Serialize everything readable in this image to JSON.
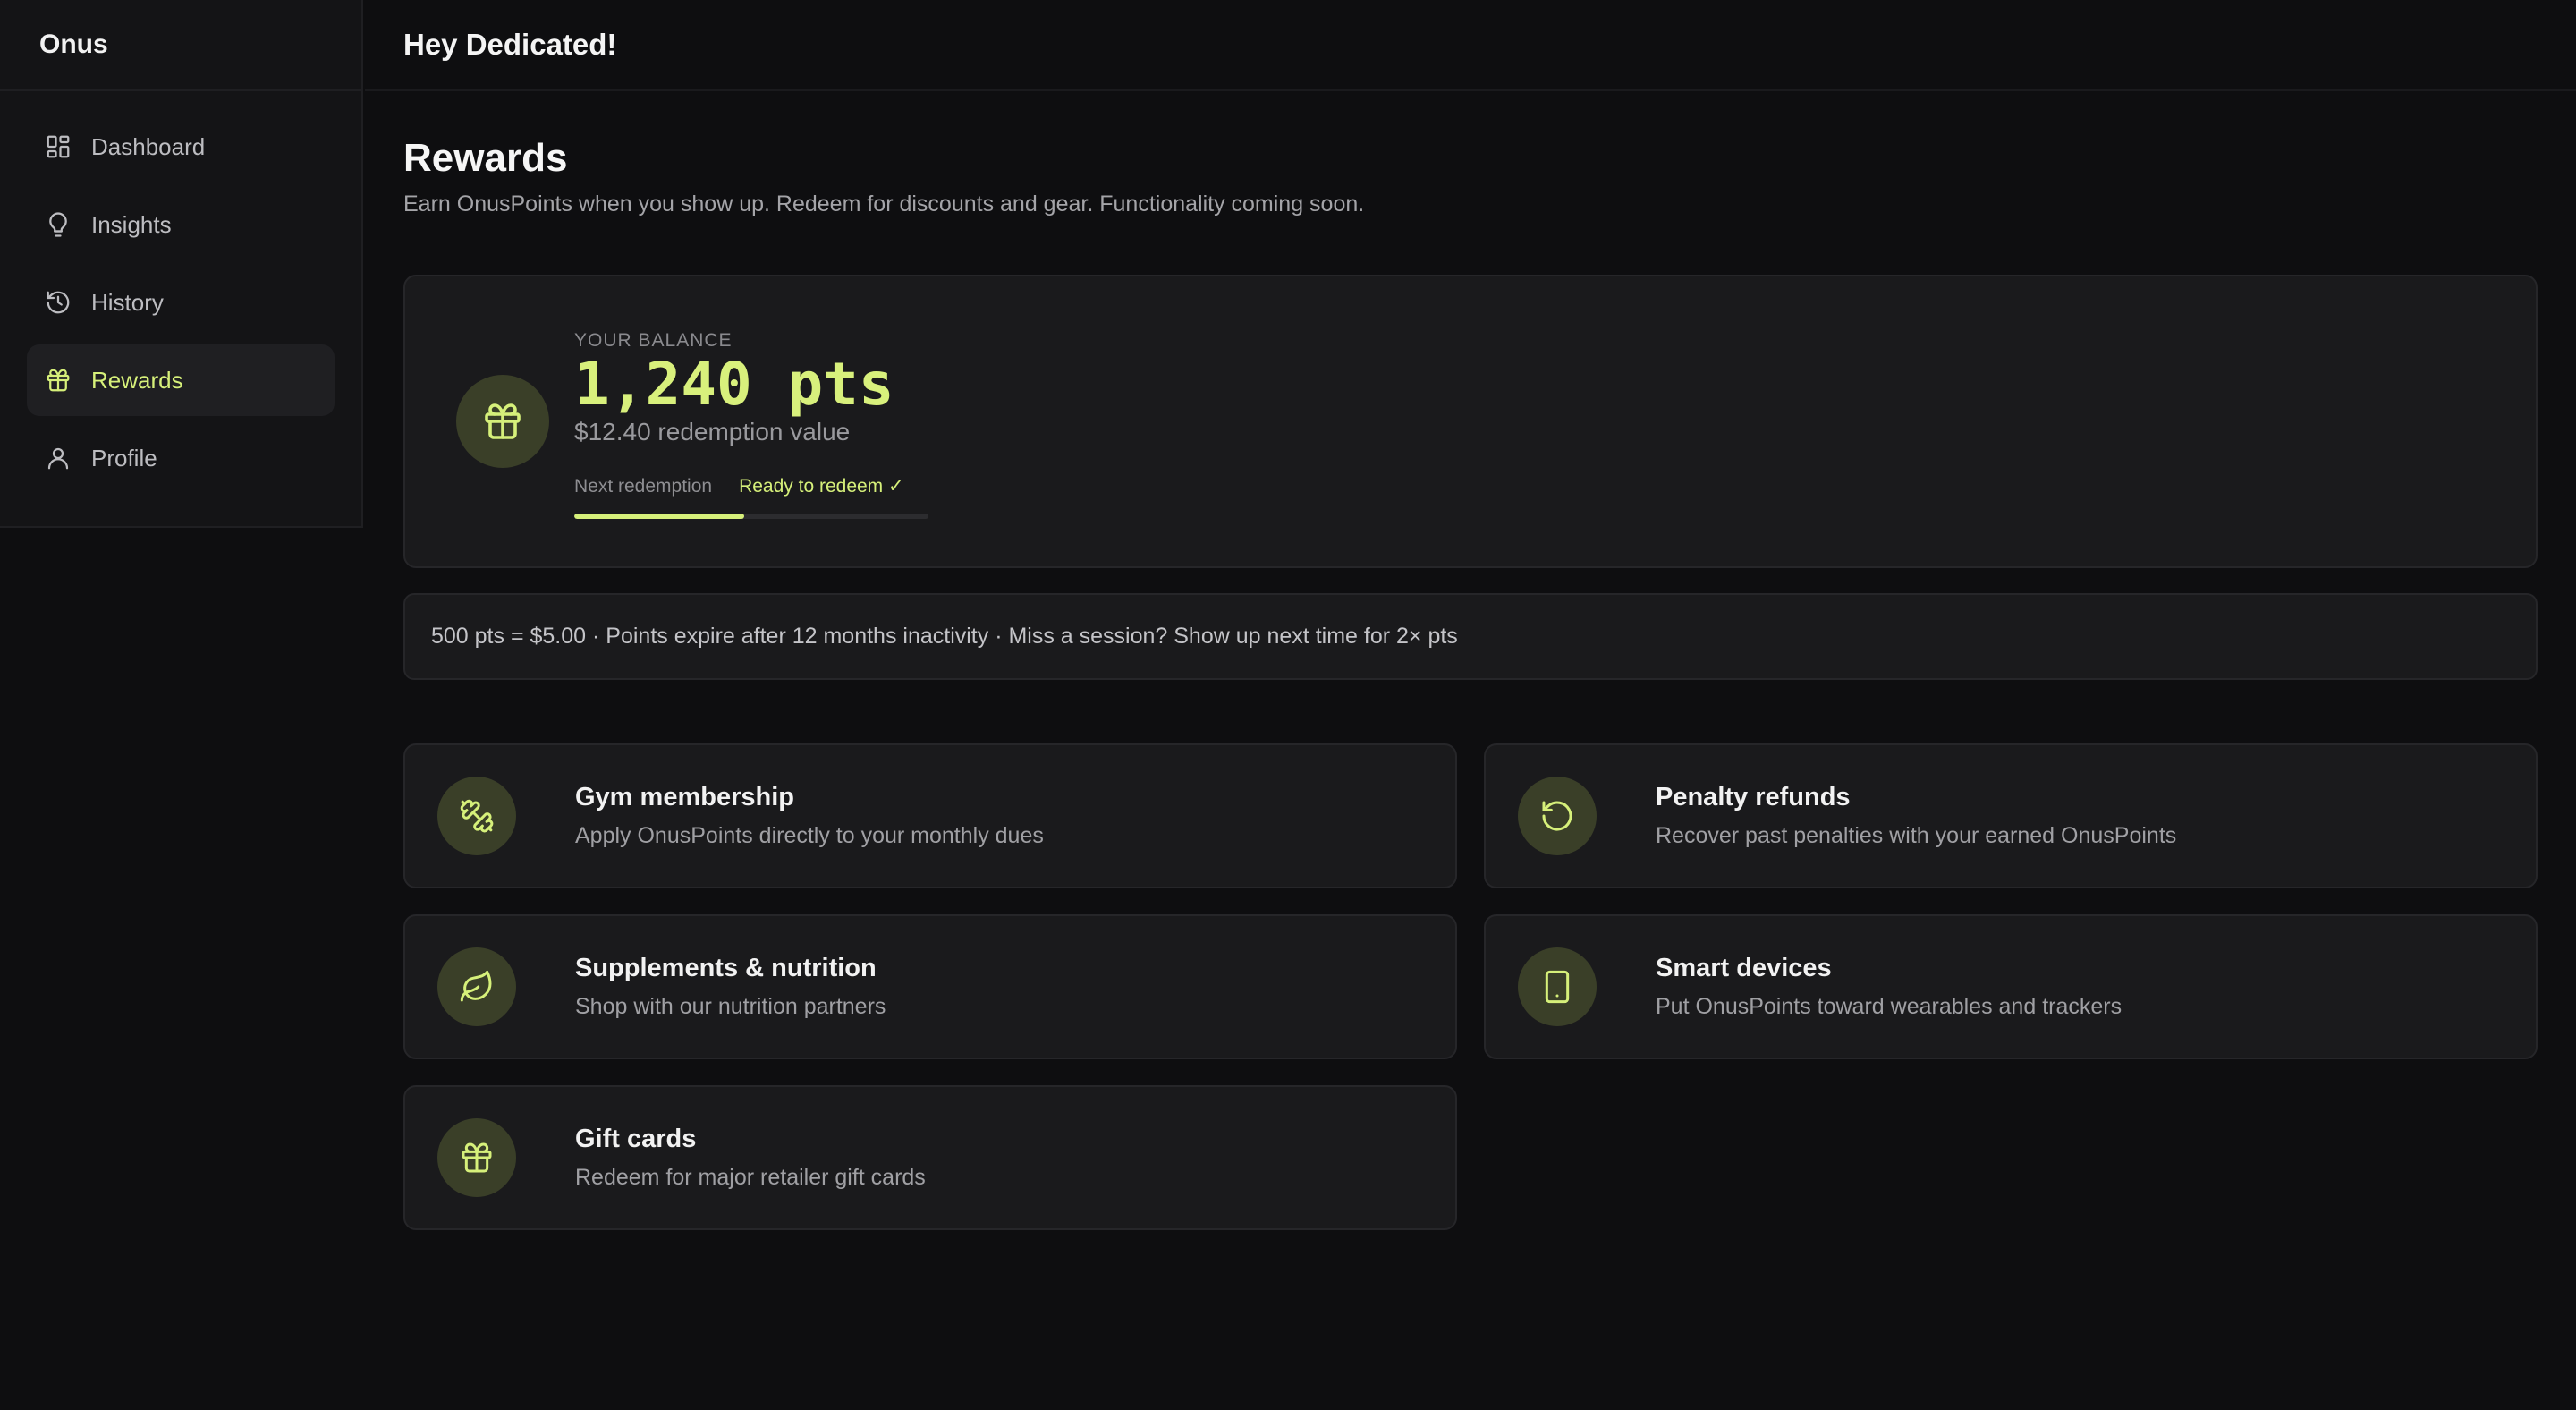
{
  "app": {
    "brand": "Onus",
    "greeting": "Hey Dedicated!"
  },
  "sidebar": {
    "items": [
      {
        "label": "Dashboard",
        "icon": "dashboard-icon",
        "active": false
      },
      {
        "label": "Insights",
        "icon": "lightbulb-icon",
        "active": false
      },
      {
        "label": "History",
        "icon": "history-icon",
        "active": false
      },
      {
        "label": "Rewards",
        "icon": "gift-icon",
        "active": true
      },
      {
        "label": "Profile",
        "icon": "user-icon",
        "active": false
      }
    ]
  },
  "page": {
    "title": "Rewards",
    "subtitle": "Earn OnusPoints when you show up. Redeem for discounts and gear. Functionality coming soon."
  },
  "balance": {
    "label": "YOUR BALANCE",
    "value": "1,240 pts",
    "redemption_value": "$12.40 redemption value",
    "next_label": "Next redemption",
    "status": "Ready to redeem ✓",
    "progress_fraction": 0.48
  },
  "info": {
    "text": "500 pts = $5.00 · Points expire after 12 months inactivity · Miss a session? Show up next time for 2× pts"
  },
  "options": [
    {
      "title": "Gym membership",
      "desc": "Apply OnusPoints directly to your monthly dues",
      "icon": "dumbbell-icon"
    },
    {
      "title": "Penalty refunds",
      "desc": "Recover past penalties with your earned OnusPoints",
      "icon": "refresh-icon"
    },
    {
      "title": "Supplements & nutrition",
      "desc": "Shop with our nutrition partners",
      "icon": "leaf-icon"
    },
    {
      "title": "Smart devices",
      "desc": "Put OnusPoints toward wearables and trackers",
      "icon": "tablet-icon"
    },
    {
      "title": "Gift cards",
      "desc": "Redeem for major retailer gift cards",
      "icon": "gift-icon"
    }
  ],
  "colors": {
    "accent": "#d6f07a",
    "background": "#0e0e10",
    "card": "#1a1a1c",
    "icon_bg": "#3a3f28"
  }
}
